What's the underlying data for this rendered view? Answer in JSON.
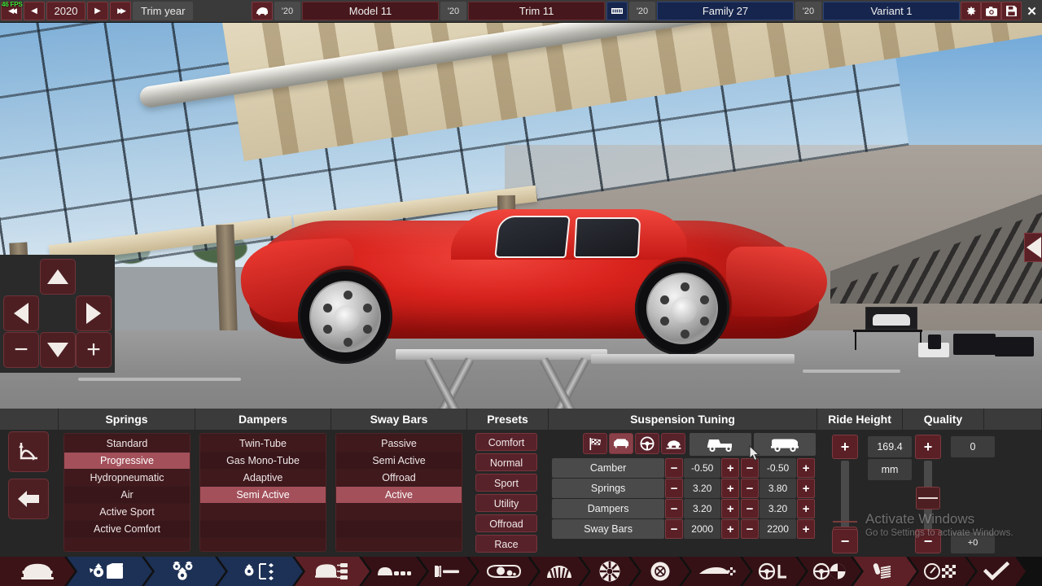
{
  "topbar": {
    "fps": "46 FPS",
    "year": "2020",
    "year_label": "Trim year",
    "first_icon": "prev-all-icon",
    "nav": {
      "first": "◀◀",
      "prev": "◀",
      "next": "▶",
      "last": "▶▶"
    },
    "model_tag": "'20",
    "model_name": "Model 11",
    "trim_tag": "'20",
    "trim_name": "Trim 11",
    "family_tag": "'20",
    "family_name": "Family 27",
    "variant_tag": "'20",
    "variant_name": "Variant 1",
    "sys": {
      "settings": "gear-icon",
      "screenshot": "camera-icon",
      "save": "save-icon",
      "close": "✕"
    }
  },
  "viewport": {
    "collapse_label": "◀",
    "dpad": {
      "up": "▲",
      "down": "▼",
      "left": "◀",
      "right": "▶",
      "minus": "−",
      "plus": "+"
    }
  },
  "panel": {
    "headers": {
      "springs": "Springs",
      "dampers": "Dampers",
      "sway_bars": "Sway Bars",
      "presets": "Presets",
      "suspension_tuning": "Suspension Tuning",
      "ride_height": "Ride Height",
      "quality": "Quality"
    },
    "springs": {
      "options": [
        "Standard",
        "Progressive",
        "Hydropneumatic",
        "Air",
        "Active Sport",
        "Active Comfort"
      ],
      "selected": "Progressive"
    },
    "dampers": {
      "options": [
        "Twin-Tube",
        "Gas Mono-Tube",
        "Adaptive",
        "Semi Active"
      ],
      "selected": "Semi Active"
    },
    "sway_bars": {
      "options": [
        "Passive",
        "Semi Active",
        "Offroad",
        "Active"
      ],
      "selected": "Active"
    },
    "presets": {
      "options": [
        "Comfort",
        "Normal",
        "Sport",
        "Utility",
        "Offroad",
        "Race"
      ]
    },
    "tuning": {
      "mode_icons": [
        "race-flag-icon",
        "comfort-sofa-icon",
        "steering-wheel-icon",
        "lowered-car-icon"
      ],
      "active_mode": "comfort-sofa-icon",
      "front_icon": "front-axle-car-icon",
      "rear_icon": "rear-axle-car-icon",
      "minus_label": "−",
      "plus_label": "+",
      "rows": [
        {
          "label": "Camber",
          "front": "-0.50",
          "rear": "-0.50"
        },
        {
          "label": "Springs",
          "front": "3.20",
          "rear": "3.80"
        },
        {
          "label": "Dampers",
          "front": "3.20",
          "rear": "3.20"
        },
        {
          "label": "Sway Bars",
          "front": "2000",
          "rear": "2200"
        }
      ]
    },
    "ride_height": {
      "value": "169.4",
      "unit": "mm",
      "plus": "+",
      "minus": "−"
    },
    "quality": {
      "value": "0",
      "delta": "+0",
      "plus": "+",
      "minus": "−"
    },
    "left_tools": {
      "graph": "curve-graph-icon",
      "back": "back-arrow-icon"
    },
    "actions": {
      "warning": {
        "icon": "warning-icon",
        "color": "#c9a227"
      },
      "next": {
        "icon": "forward-arrow-icon",
        "color": "#5d2026"
      },
      "help": {
        "icon": "help-icon",
        "color": "#131a66"
      }
    }
  },
  "watermark": {
    "line1": "Activate Windows",
    "line2": "Go to Settings to activate Windows."
  },
  "navbar": {
    "items": [
      {
        "name": "body-icon",
        "style": "dark"
      },
      {
        "name": "engine-family-icon",
        "style": "blue"
      },
      {
        "name": "engine-variant-icon",
        "style": "blue"
      },
      {
        "name": "engine-tune-icon",
        "style": "blue"
      },
      {
        "name": "car-model-icon",
        "style": "red"
      },
      {
        "name": "chassis-icon",
        "style": "darker"
      },
      {
        "name": "interior-icon",
        "style": "darker"
      },
      {
        "name": "aero-icon",
        "style": "darker"
      },
      {
        "name": "gearbox-icon",
        "style": "darker"
      },
      {
        "name": "wheels-icon",
        "style": "darker"
      },
      {
        "name": "brakes-icon",
        "style": "darker"
      },
      {
        "name": "aerodynamics-icon",
        "style": "darker"
      },
      {
        "name": "steering-icon",
        "style": "darker"
      },
      {
        "name": "drivetrain-icon",
        "style": "darker"
      },
      {
        "name": "suspension-icon",
        "style": "red"
      },
      {
        "name": "test-icon",
        "style": "darker"
      },
      {
        "name": "finish-icon",
        "style": "darker"
      }
    ]
  }
}
